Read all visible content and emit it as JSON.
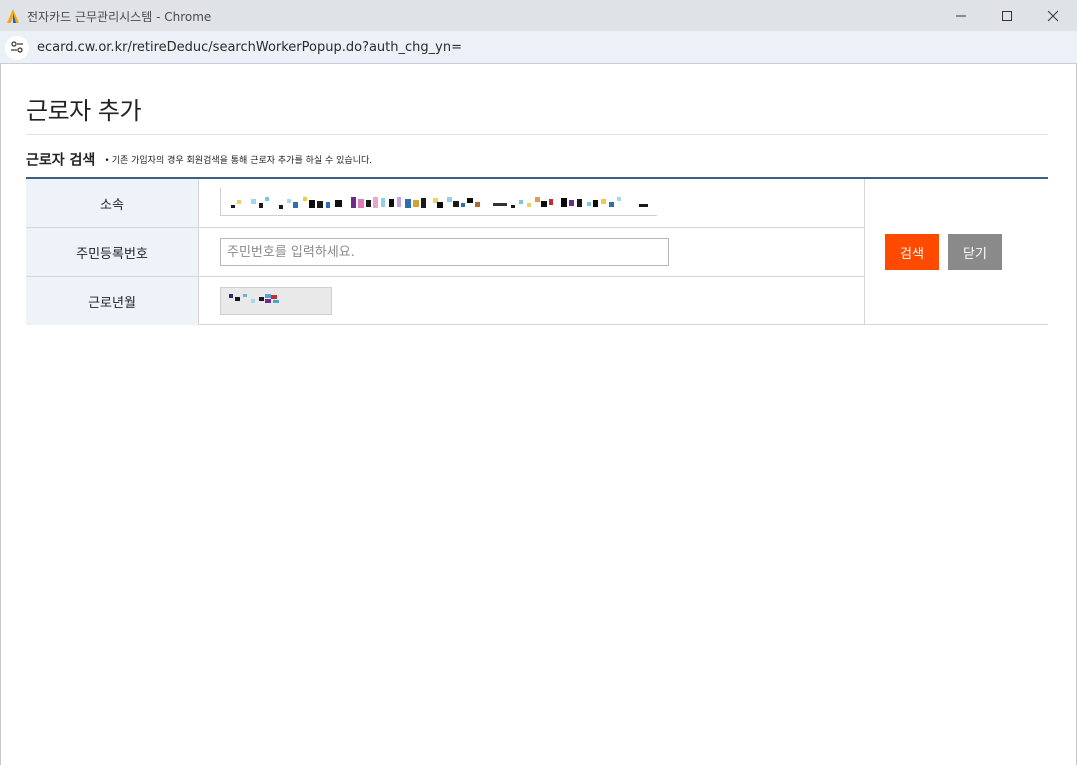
{
  "window": {
    "title": "전자카드 근무관리시스템 - Chrome"
  },
  "addressbar": {
    "url": "ecard.cw.or.kr/retireDeduc/searchWorkerPopup.do?auth_chg_yn="
  },
  "page": {
    "title": "근로자 추가"
  },
  "section": {
    "title": "근로자 검색",
    "bullet": "•",
    "note": "기존 가입자의 경우 회원검색을 통해 근로자 추가를 하실 수 있습니다."
  },
  "form": {
    "rows": [
      {
        "label": "소속"
      },
      {
        "label": "주민등록번호",
        "placeholder": "주민번호를 입력하세요."
      },
      {
        "label": "근로년월"
      }
    ],
    "search_button": "검색",
    "close_button": "닫기"
  },
  "colors": {
    "accent_button": "#ff4a00",
    "secondary_button": "#8a8a8a",
    "table_header_bg": "#eef3f9",
    "table_top_border": "#3d5f82"
  },
  "icons": {
    "app": "app-logo-icon",
    "minimize": "minimize-icon",
    "maximize": "maximize-icon",
    "close": "close-icon",
    "site_info": "site-info-icon"
  }
}
